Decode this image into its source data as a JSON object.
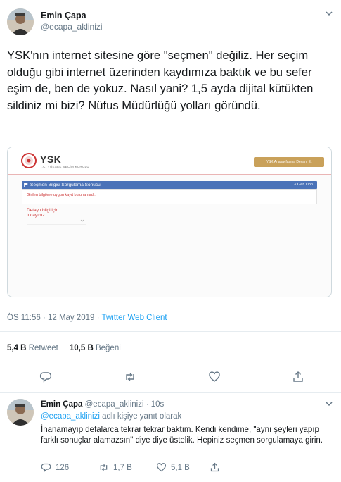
{
  "tweet": {
    "author_name": "Emin Çapa",
    "author_handle": "@ecapa_aklinizi",
    "text": "YSK'nın internet sitesine göre \"seçmen\" değiliz. Her seçim olduğu gibi internet üzerinden kaydımıza baktık ve bu sefer eşim de, ben de yokuz. Nasıl yani? 1,5 ayda dijital kütükten sildiniz mi bizi? Nüfus Müdürlüğü yolları göründü.",
    "timestamp": "ÖS 11:56 · 12 May 2019 · ",
    "client": "Twitter Web Client",
    "retweets_count": "5,4 B",
    "retweets_label": " Retweet",
    "likes_count": "10,5 B",
    "likes_label": " Beğeni"
  },
  "media": {
    "site_title": "YSK",
    "site_subtitle": "T.C. YÜKSEK SEÇİM KURULU",
    "home_button": "YSK Anasayfasına Devam Et",
    "panel_title": "Seçmen Bilgisi Sorgulama Sonucu",
    "back_link": "« Geri Dön",
    "error_message": "Girilen bilgilere uygun kayıt bulunamadı.",
    "detail_label": "Detaylı bilgi için\ntıklayınız"
  },
  "reply": {
    "author_name": "Emin Çapa",
    "author_handle": " @ecapa_aklinizi · 10s",
    "context_mention": "@ecapa_aklinizi",
    "context_rest": " adlı kişiye yanıt olarak",
    "text": "İnanamayıp defalarca tekrar tekrar baktım. Kendi kendime, \"aynı şeyleri yapıp farklı sonuçlar alamazsın\" diye diye üstelik. Hepiniz seçmen sorgulamaya girin.",
    "replies": "126",
    "retweets": "1,7 B",
    "likes": "5,1 B"
  },
  "icons": {
    "reply": "reply-icon",
    "retweet": "retweet-icon",
    "like": "heart-icon",
    "share": "share-icon",
    "caret": "chevron-down-icon"
  },
  "colors": {
    "link": "#1da1f2",
    "secondary_text": "#657786",
    "ysk_red": "#cc3333",
    "ysk_panel_blue": "#4a72b8",
    "ysk_gold": "#c9a15a"
  }
}
